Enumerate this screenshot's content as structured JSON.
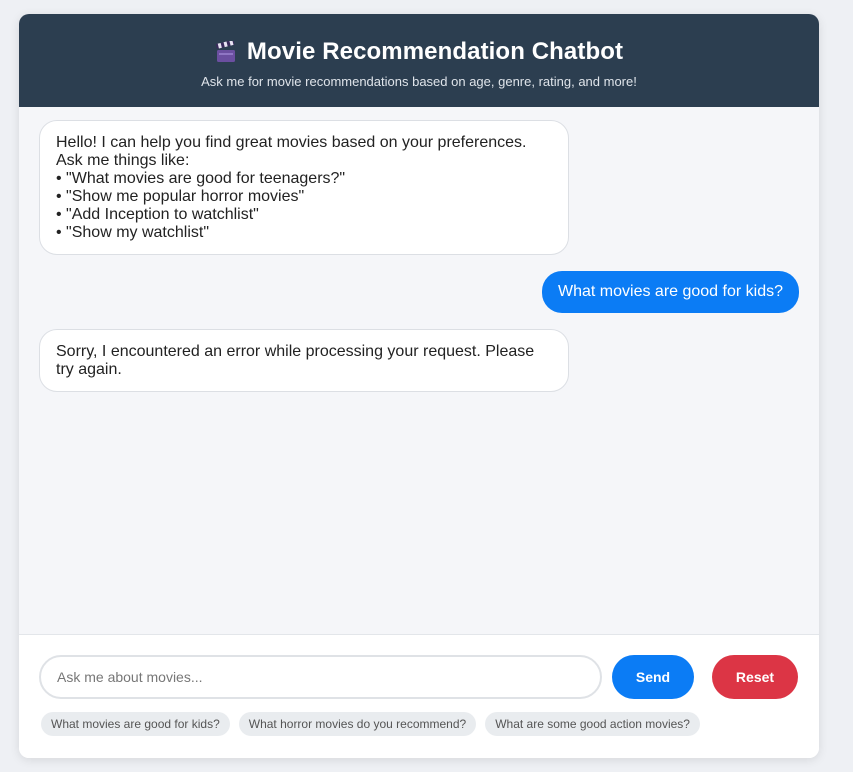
{
  "header": {
    "title": "Movie Recommendation Chatbot",
    "subtitle": "Ask me for movie recommendations based on age, genre, rating, and more!",
    "icon": "clapperboard-icon"
  },
  "messages": {
    "bot_intro": {
      "lines": [
        "Hello! I can help you find great movies based on your preferences.",
        "Ask me things like:",
        "• \"What movies are good for teenagers?\"",
        "• \"Show me popular horror movies\"",
        "• \"Add Inception to watchlist\"",
        "• \"Show my watchlist\""
      ]
    },
    "user_query": "What movies are good for kids?",
    "bot_error": "Sorry, I encountered an error while processing your request. Please try again."
  },
  "input": {
    "placeholder": "Ask me about movies...",
    "value": ""
  },
  "buttons": {
    "send": "Send",
    "reset": "Reset"
  },
  "suggestions": [
    "What movies are good for kids?",
    "What horror movies do you recommend?",
    "What are some good action movies?"
  ],
  "colors": {
    "header_bg": "#2c3e50",
    "primary": "#0b7cf5",
    "danger": "#dc3545"
  }
}
